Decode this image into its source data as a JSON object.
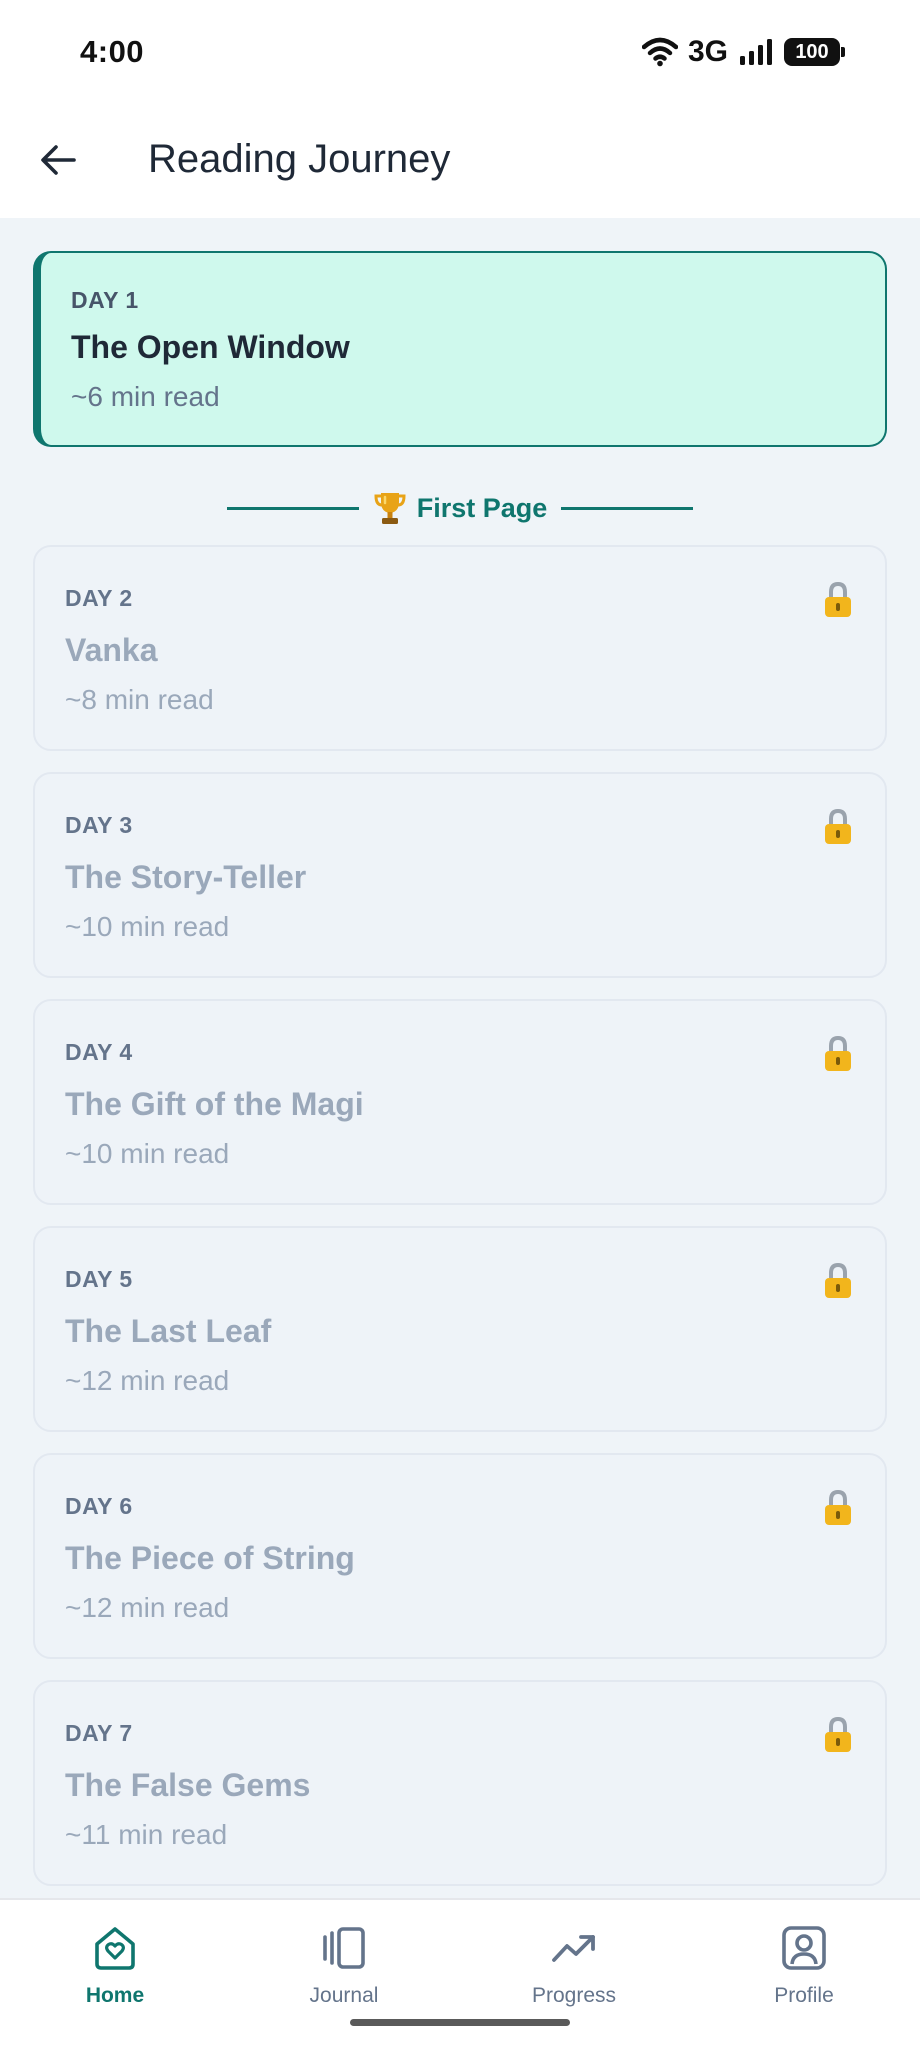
{
  "status_bar": {
    "time": "4:00",
    "network": "3G",
    "battery": "100"
  },
  "header": {
    "title": "Reading Journey"
  },
  "journey": {
    "days": [
      {
        "day": "DAY 1",
        "title": "The Open Window",
        "time": "~6 min read"
      },
      {
        "day": "DAY 2",
        "title": "Vanka",
        "time": "~8 min read"
      },
      {
        "day": "DAY 3",
        "title": "The Story-Teller",
        "time": "~10 min read"
      },
      {
        "day": "DAY 4",
        "title": "The Gift of the Magi",
        "time": "~10 min read"
      },
      {
        "day": "DAY 5",
        "title": "The Last Leaf",
        "time": "~12 min read"
      },
      {
        "day": "DAY 6",
        "title": "The Piece of String",
        "time": "~12 min read"
      },
      {
        "day": "DAY 7",
        "title": "The False Gems",
        "time": "~11 min read"
      }
    ],
    "milestone_label": "First Page"
  },
  "nav": {
    "items": [
      {
        "label": "Home",
        "icon": "home-heart-icon"
      },
      {
        "label": "Journal",
        "icon": "journal-icon"
      },
      {
        "label": "Progress",
        "icon": "trending-up-icon"
      },
      {
        "label": "Profile",
        "icon": "profile-icon"
      }
    ]
  },
  "colors": {
    "accent": "#0f766e",
    "active_card_bg": "#cff9ed",
    "locked_text": "#9aa8ba",
    "page_bg": "#eff4f8"
  }
}
